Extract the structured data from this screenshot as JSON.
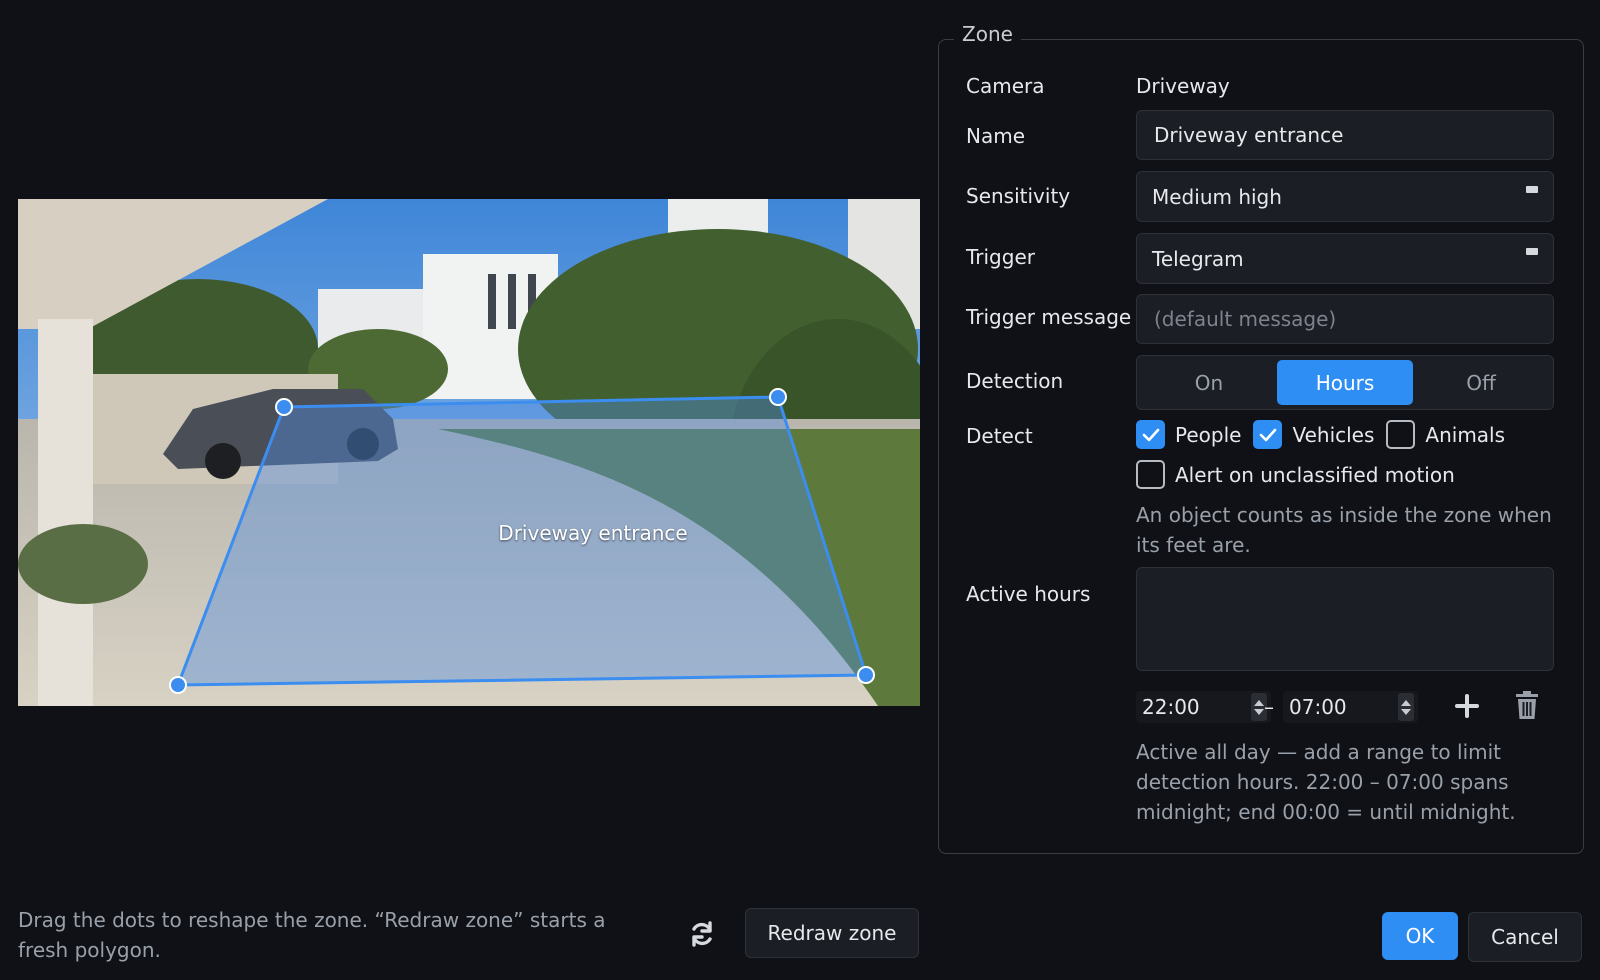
{
  "preview": {
    "zone_label": "Driveway entrance"
  },
  "zone": {
    "legend": "Zone",
    "camera_label": "Camera",
    "camera_value": "Driveway",
    "name_label": "Name",
    "name_value": "Driveway entrance",
    "sensitivity_label": "Sensitivity",
    "sensitivity_value": "Medium high",
    "trigger_label": "Trigger",
    "trigger_value": "Telegram",
    "trigger_message_label": "Trigger message",
    "trigger_message_placeholder": "(default message)",
    "detection_label": "Detection",
    "detection_options": [
      "On",
      "Hours",
      "Off"
    ],
    "detection_selected": "Hours",
    "detect_label": "Detect",
    "detect_options": [
      {
        "label": "People",
        "checked": true
      },
      {
        "label": "Vehicles",
        "checked": true
      },
      {
        "label": "Animals",
        "checked": false
      }
    ],
    "alert_unclassified_label": "Alert on unclassified motion",
    "alert_unclassified_checked": false,
    "detect_help": "An object counts as inside the zone when its feet are.",
    "active_hours_label": "Active hours",
    "start_time": "22:00",
    "time_separator": "–",
    "end_time": "07:00",
    "active_hours_help": "Active all day — add a range to limit detection hours. 22:00 – 07:00 spans midnight; end 00:00 = until midnight."
  },
  "footer": {
    "help": "Drag the dots to reshape the zone. “Redraw zone” starts a fresh polygon.",
    "redraw_label": "Redraw zone",
    "ok_label": "OK",
    "cancel_label": "Cancel"
  },
  "colors": {
    "accent": "#2f8ef4",
    "background": "#0f1116",
    "field": "#1b1e24"
  },
  "icons": [
    "refresh-icon",
    "plus-icon",
    "trash-icon",
    "check-icon",
    "chevron-down-icon"
  ]
}
